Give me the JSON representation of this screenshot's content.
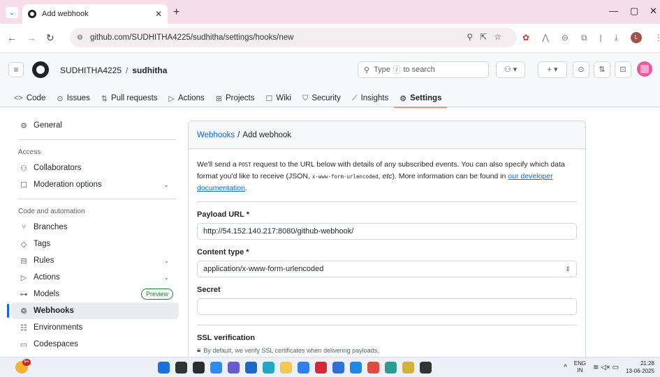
{
  "browser": {
    "tab_title": "Add webhook",
    "url": "github.com/SUDHITHA4225/sudhitha/settings/hooks/new",
    "profile_initial": "L"
  },
  "header": {
    "owner": "SUDHITHA4225",
    "separator": "/",
    "repo": "sudhitha",
    "search_prefix": "Type",
    "search_key": "/",
    "search_suffix": "to search"
  },
  "repo_nav": [
    {
      "label": "Code",
      "icon": "<>"
    },
    {
      "label": "Issues",
      "icon": "⊙"
    },
    {
      "label": "Pull requests",
      "icon": "⇅"
    },
    {
      "label": "Actions",
      "icon": "▷"
    },
    {
      "label": "Projects",
      "icon": "⊞"
    },
    {
      "label": "Wiki",
      "icon": "☐"
    },
    {
      "label": "Security",
      "icon": "⛉"
    },
    {
      "label": "Insights",
      "icon": "⟋"
    },
    {
      "label": "Settings",
      "icon": "⚙"
    }
  ],
  "sidebar": {
    "general": "General",
    "access_heading": "Access",
    "collaborators": "Collaborators",
    "moderation": "Moderation options",
    "code_heading": "Code and automation",
    "branches": "Branches",
    "tags": "Tags",
    "rules": "Rules",
    "actions": "Actions",
    "models": "Models",
    "preview_badge": "Preview",
    "webhooks": "Webhooks",
    "environments": "Environments",
    "codespaces": "Codespaces"
  },
  "panel": {
    "crumb_link": "Webhooks",
    "crumb_sep": "/",
    "crumb_current": "Add webhook",
    "intro_1": "We'll send a ",
    "intro_post": "POST",
    "intro_2": " request to the URL below with details of any subscribed events. You can also specify which data format you'd like to receive (JSON, ",
    "intro_mono": "x-www-form-urlencoded",
    "intro_3": ", ",
    "intro_etc": "etc",
    "intro_4": "). More information can be found in ",
    "intro_link": "our developer documentation",
    "intro_5": ".",
    "payload_label": "Payload URL *",
    "payload_value": "http://54.152.140.217:8080/github-webhook/",
    "content_label": "Content type *",
    "content_value": "application/x-www-form-urlencoded",
    "secret_label": "Secret",
    "secret_value": "",
    "ssl_label": "SSL verification",
    "ssl_desc": "By default, we verify SSL certificates when delivering payloads."
  },
  "taskbar": {
    "weather_badge": "9+",
    "lang_1": "ENG",
    "lang_2": "IN",
    "time": "21:28",
    "date": "13-06-2025",
    "apps": [
      "#1e6fd9",
      "#333333",
      "#2d2d2d",
      "#2c8cf4",
      "#6a5acd",
      "#1b6ac9",
      "#22a7c7",
      "#f2c94c",
      "#2f80ed",
      "#d62839",
      "#2f6fd8",
      "#1e88e5",
      "#e04a3f",
      "#2a9d8f",
      "#d0b23a",
      "#333333"
    ]
  }
}
